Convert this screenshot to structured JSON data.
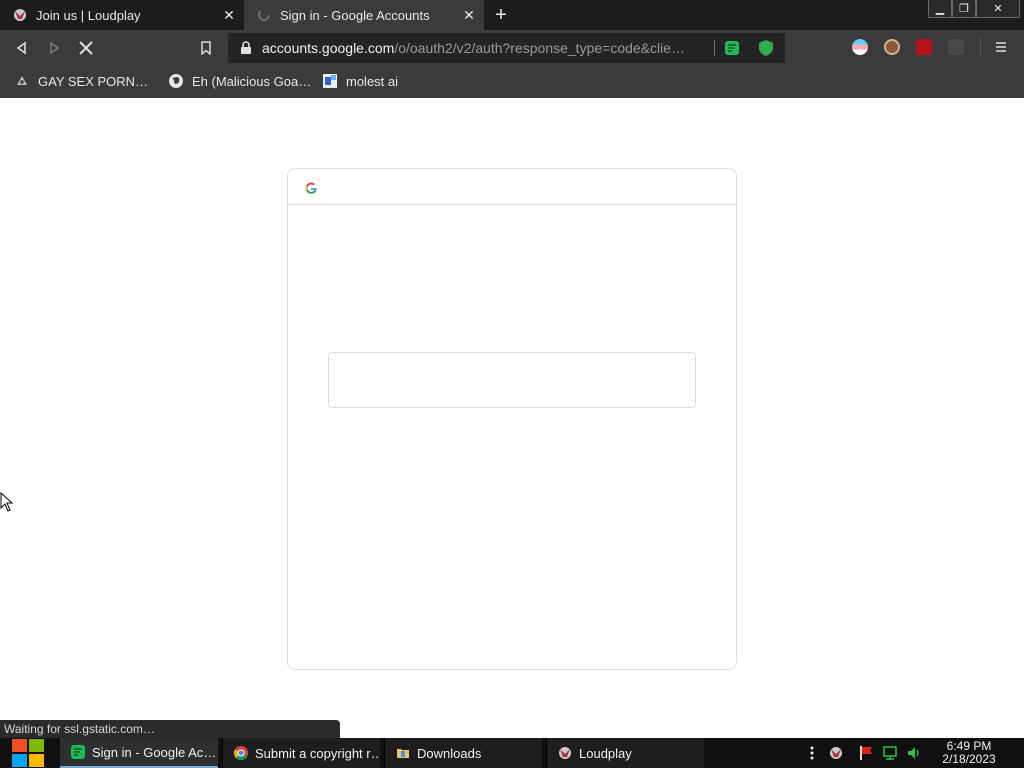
{
  "tabs": [
    {
      "title": "Join us | Loudplay",
      "active": false
    },
    {
      "title": "Sign in - Google Accounts",
      "active": true
    }
  ],
  "toolbar": {
    "url_host": "accounts.google.com",
    "url_path": "/o/oauth2/v2/auth?response_type=code&clie…"
  },
  "bookmarks": [
    {
      "label": "GAY SEX PORN…"
    },
    {
      "label": "Eh (Malicious Goa…"
    },
    {
      "label": "molest ai"
    }
  ],
  "status": {
    "text": "Waiting for ssl.gstatic.com…"
  },
  "taskbar": {
    "items": [
      {
        "label": "Sign in - Google Ac…"
      },
      {
        "label": "Submit a copyright r…"
      },
      {
        "label": "Downloads"
      },
      {
        "label": "Loudplay"
      }
    ],
    "time": "6:49 PM",
    "date": "2/18/2023"
  },
  "colors": {
    "chrome_dark": "#1c1c1c",
    "toolbar": "#3b3b3b",
    "taskbar": "#101010",
    "card_border": "#dadce0"
  }
}
